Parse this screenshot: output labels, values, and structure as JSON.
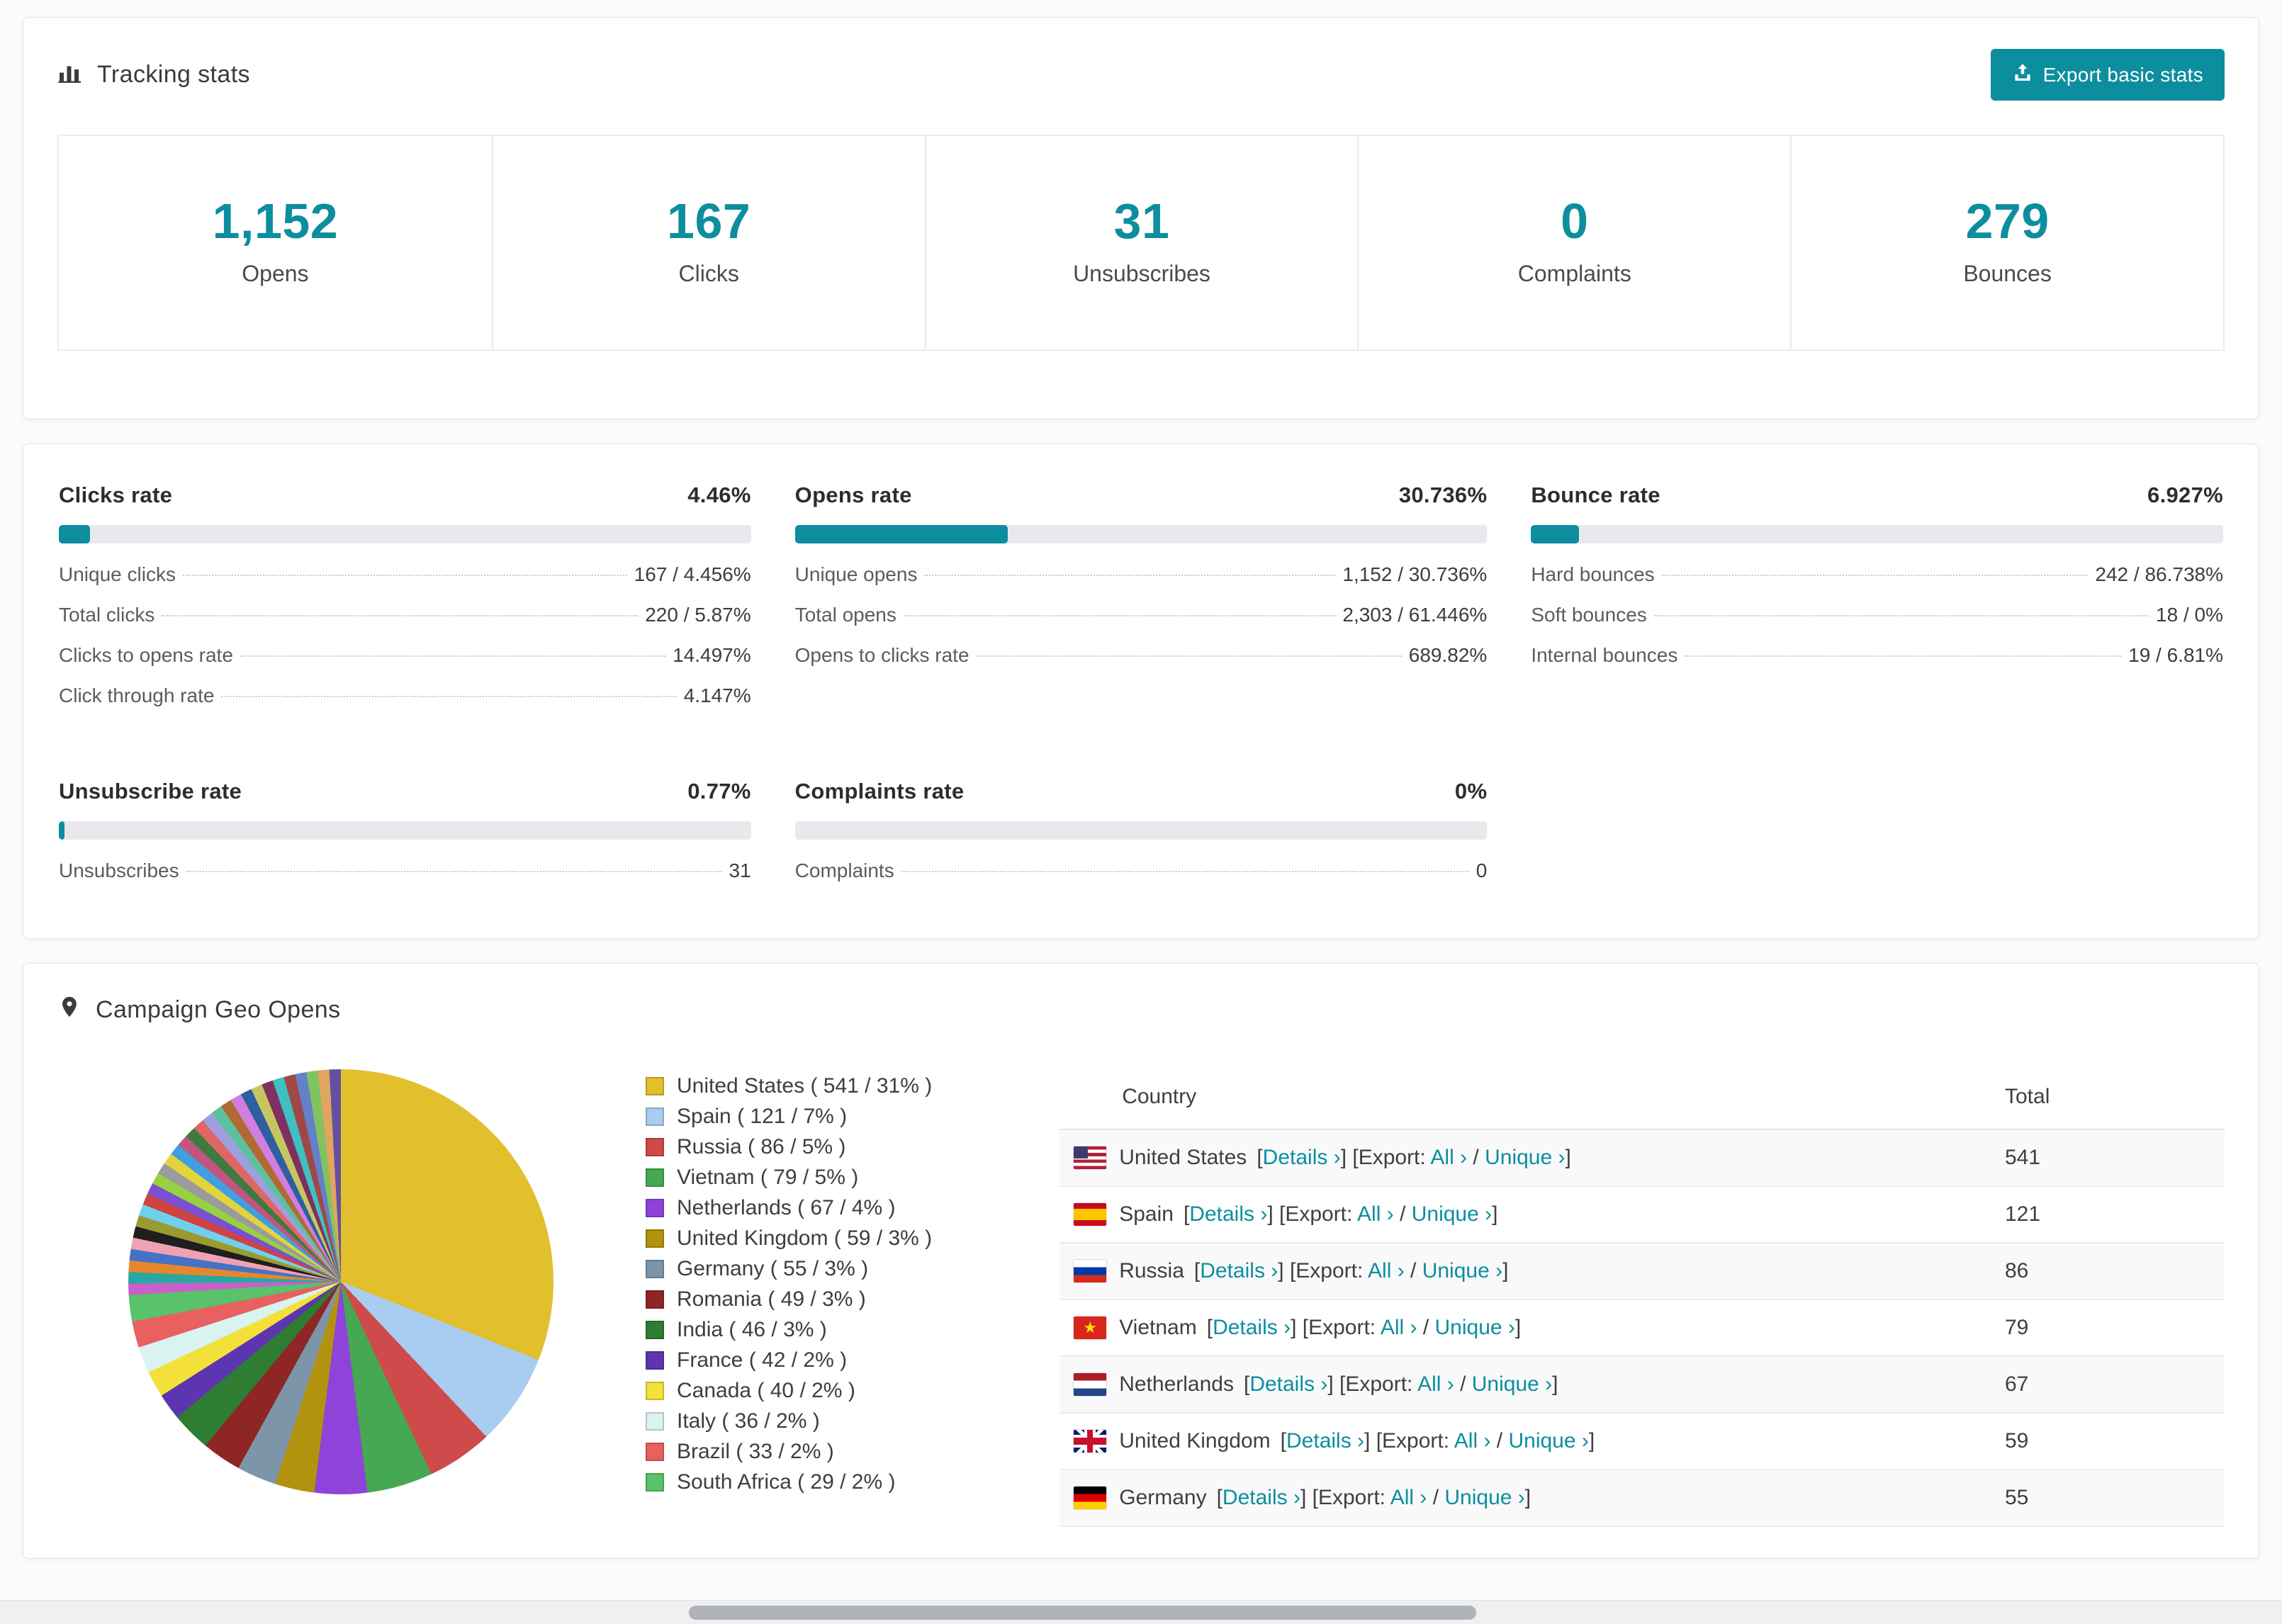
{
  "colors": {
    "accent": "#0c8e9f"
  },
  "tracking": {
    "title": "Tracking stats",
    "export_button": "Export basic stats",
    "stats": [
      {
        "value": "1,152",
        "label": "Opens"
      },
      {
        "value": "167",
        "label": "Clicks"
      },
      {
        "value": "31",
        "label": "Unsubscribes"
      },
      {
        "value": "0",
        "label": "Complaints"
      },
      {
        "value": "279",
        "label": "Bounces"
      }
    ]
  },
  "rates": [
    {
      "title": "Clicks rate",
      "value": "4.46%",
      "percent": 4.46,
      "rows": [
        {
          "label": "Unique clicks",
          "value": "167 / 4.456%"
        },
        {
          "label": "Total clicks",
          "value": "220 / 5.87%"
        },
        {
          "label": "Clicks to opens rate",
          "value": "14.497%"
        },
        {
          "label": "Click through rate",
          "value": "4.147%"
        }
      ]
    },
    {
      "title": "Opens rate",
      "value": "30.736%",
      "percent": 30.736,
      "rows": [
        {
          "label": "Unique opens",
          "value": "1,152 / 30.736%"
        },
        {
          "label": "Total opens",
          "value": "2,303 / 61.446%"
        },
        {
          "label": "Opens to clicks rate",
          "value": "689.82%"
        }
      ]
    },
    {
      "title": "Bounce rate",
      "value": "6.927%",
      "percent": 6.927,
      "rows": [
        {
          "label": "Hard bounces",
          "value": "242 / 86.738%"
        },
        {
          "label": "Soft bounces",
          "value": "18 / 0%"
        },
        {
          "label": "Internal bounces",
          "value": "19 / 6.81%"
        }
      ]
    },
    {
      "title": "Unsubscribe rate",
      "value": "0.77%",
      "percent": 0.77,
      "rows": [
        {
          "label": "Unsubscribes",
          "value": "31"
        }
      ]
    },
    {
      "title": "Complaints rate",
      "value": "0%",
      "percent": 0,
      "rows": [
        {
          "label": "Complaints",
          "value": "0"
        }
      ]
    }
  ],
  "geo": {
    "title": "Campaign Geo Opens",
    "chart_data": {
      "type": "pie",
      "title": "Campaign Geo Opens",
      "legend_position": "right",
      "slices": [
        {
          "label": "United States",
          "value": 541,
          "pct": 31,
          "color": "#e2bf2d"
        },
        {
          "label": "Spain",
          "value": 121,
          "pct": 7,
          "color": "#a8cdf0"
        },
        {
          "label": "Russia",
          "value": 86,
          "pct": 5,
          "color": "#cf4a4a"
        },
        {
          "label": "Vietnam",
          "value": 79,
          "pct": 5,
          "color": "#46a852"
        },
        {
          "label": "Netherlands",
          "value": 67,
          "pct": 4,
          "color": "#8e44d8"
        },
        {
          "label": "United Kingdom",
          "value": 59,
          "pct": 3,
          "color": "#b3920e"
        },
        {
          "label": "Germany",
          "value": 55,
          "pct": 3,
          "color": "#7d95a8"
        },
        {
          "label": "Romania",
          "value": 49,
          "pct": 3,
          "color": "#8e2626"
        },
        {
          "label": "India",
          "value": 46,
          "pct": 3,
          "color": "#2e7d32"
        },
        {
          "label": "France",
          "value": 42,
          "pct": 2,
          "color": "#5e35b1"
        },
        {
          "label": "Canada",
          "value": 40,
          "pct": 2,
          "color": "#f3e13a"
        },
        {
          "label": "Italy",
          "value": 36,
          "pct": 2,
          "color": "#d8f3f0"
        },
        {
          "label": "Brazil",
          "value": 33,
          "pct": 2,
          "color": "#e86060"
        },
        {
          "label": "South Africa",
          "value": 29,
          "pct": 2,
          "color": "#59c26a"
        }
      ],
      "others": {
        "pct": 26,
        "colors": [
          "#c95fc9",
          "#2aa7a0",
          "#e6872e",
          "#4472c4",
          "#f0a1b4",
          "#1f1f1f",
          "#9a9a30",
          "#6fd0ee",
          "#d04343",
          "#7a4fd0",
          "#96d13f",
          "#9b9b9b",
          "#e3d43b",
          "#3f9fe0",
          "#c2557f",
          "#3f7a3f",
          "#e06666",
          "#9f9fe0",
          "#5fc0a0",
          "#b06a32",
          "#d07fe0",
          "#2f5fa0",
          "#c6c661",
          "#803060",
          "#3fc0c0",
          "#a04848",
          "#6481c8",
          "#7fc45f",
          "#e0a55f",
          "#61519f"
        ]
      }
    },
    "table": {
      "headers": [
        "Country",
        "Total"
      ],
      "details_label": "Details",
      "export_label": "Export:",
      "all_label": "All",
      "unique_label": "Unique",
      "chevron": "›",
      "rows": [
        {
          "country": "United States",
          "flag": "us",
          "total": "541"
        },
        {
          "country": "Spain",
          "flag": "es",
          "total": "121"
        },
        {
          "country": "Russia",
          "flag": "ru",
          "total": "86"
        },
        {
          "country": "Vietnam",
          "flag": "vn",
          "total": "79"
        },
        {
          "country": "Netherlands",
          "flag": "nl",
          "total": "67"
        },
        {
          "country": "United Kingdom",
          "flag": "gb",
          "total": "59"
        },
        {
          "country": "Germany",
          "flag": "de",
          "total": "55"
        }
      ]
    }
  }
}
